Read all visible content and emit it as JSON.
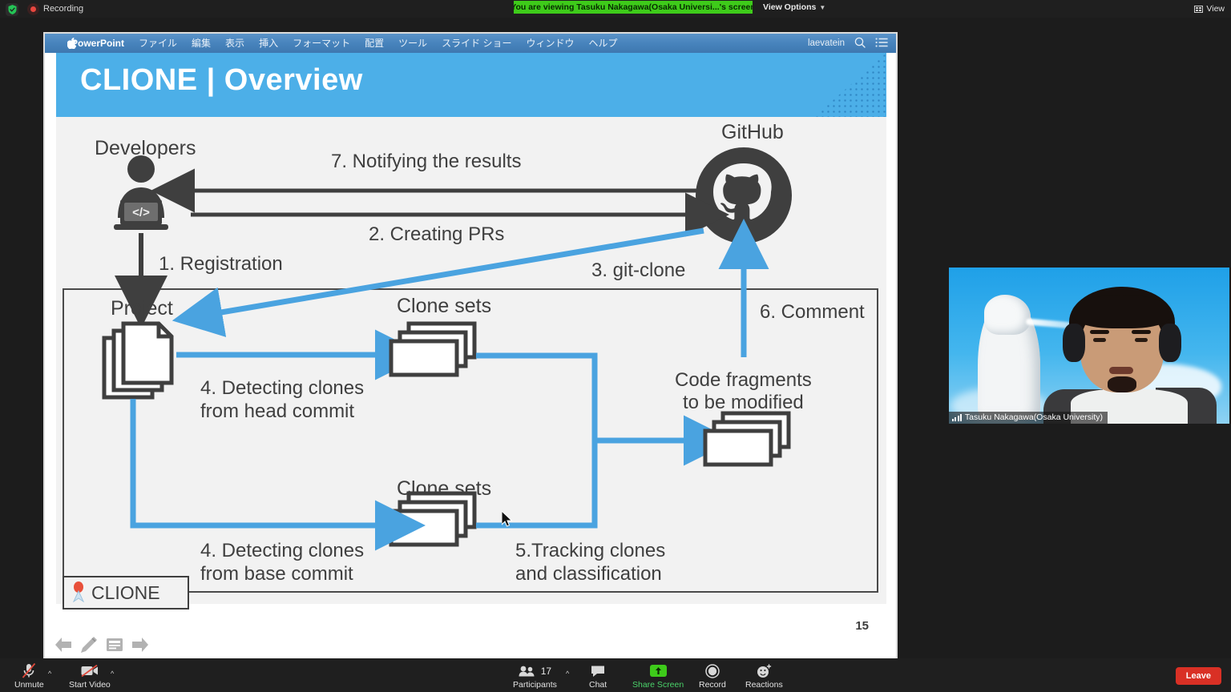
{
  "topbar": {
    "recording_label": "Recording",
    "viewing_banner": "You are viewing Tasuku Nakagawa(Osaka Universi...'s screen",
    "view_options_label": "View Options",
    "view_button_label": "View",
    "banner_color": "#3ecb1a"
  },
  "powerpoint": {
    "app_name": "PowerPoint",
    "menu_items": [
      "ファイル",
      "編集",
      "表示",
      "挿入",
      "フォーマット",
      "配置",
      "ツール",
      "スライド ショー",
      "ウィンドウ",
      "ヘルプ"
    ],
    "user_name": "laevatein"
  },
  "slide": {
    "title": "CLIONE | Overview",
    "page_number": "15",
    "header_color": "#4cafe8",
    "accent_blue": "#4aa3e0",
    "labels": {
      "developers": "Developers",
      "github": "GitHub",
      "project": "Project",
      "clone_sets_top": "Clone sets",
      "clone_sets_bottom": "Clone sets",
      "code_fragments_line1": "Code fragments",
      "code_fragments_line2": "to be modified",
      "clione_box": "CLIONE"
    },
    "steps": {
      "step1": "1. Registration",
      "step2": "2. Creating PRs",
      "step3": "3. git-clone",
      "step4_head_line1": "4. Detecting clones",
      "step4_head_line2": "from head commit",
      "step4_base_line1": "4. Detecting clones",
      "step4_base_line2": "from base commit",
      "step5_line1": "5.Tracking clones",
      "step5_line2": "and classification",
      "step6": "6. Comment",
      "step7": "7. Notifying the results"
    },
    "nav_icons": [
      "previous-arrow-icon",
      "pen-icon",
      "notes-icon",
      "next-arrow-icon"
    ]
  },
  "video": {
    "participant_name": "Tasuku Nakagawa(Osaka University)"
  },
  "bottombar": {
    "items": [
      {
        "label": "Unmute",
        "icon": "microphone-muted-icon",
        "has_caret": true
      },
      {
        "label": "Start Video",
        "icon": "camera-off-icon",
        "has_caret": true
      },
      {
        "label": "Participants",
        "icon": "participants-icon",
        "count": "17",
        "has_caret": true
      },
      {
        "label": "Chat",
        "icon": "chat-bubble-icon",
        "has_caret": false
      },
      {
        "label": "Share Screen",
        "icon": "share-screen-icon",
        "has_caret": false
      },
      {
        "label": "Record",
        "icon": "record-icon",
        "has_caret": false
      },
      {
        "label": "Reactions",
        "icon": "reactions-smiley-icon",
        "has_caret": false
      }
    ],
    "leave_label": "Leave",
    "leave_color": "#d93025"
  }
}
